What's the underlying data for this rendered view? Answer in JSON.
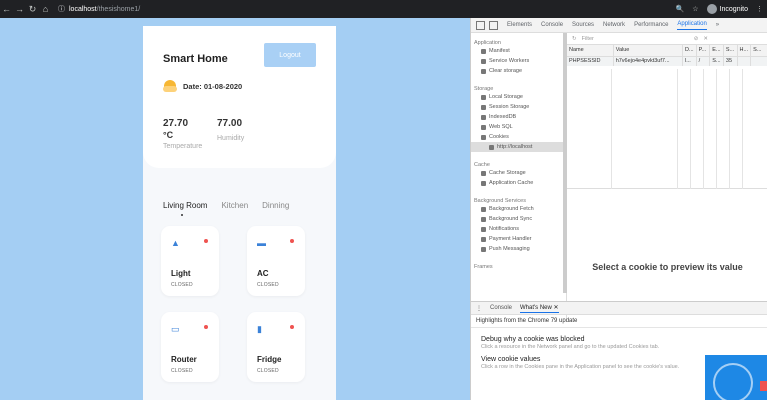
{
  "browser": {
    "url_host": "localhost",
    "url_path": "/thesishome1/",
    "profile_label": "Incognito"
  },
  "app": {
    "title": "Smart Home",
    "logout_label": "Logout",
    "date_text": "Date: 01-08-2020",
    "temperature": {
      "value": "27.70",
      "unit": "°C",
      "label": "Temperature"
    },
    "humidity": {
      "value": "77.00",
      "label": "Humidity"
    },
    "rooms": [
      {
        "label": "Living Room",
        "active": true
      },
      {
        "label": "Kitchen",
        "active": false
      },
      {
        "label": "Dinning",
        "active": false
      }
    ],
    "devices": [
      {
        "name": "Light",
        "state": "CLOSED",
        "icon": "lamp-icon"
      },
      {
        "name": "AC",
        "state": "CLOSED",
        "icon": "ac-icon"
      },
      {
        "name": "Router",
        "state": "CLOSED",
        "icon": "router-icon"
      },
      {
        "name": "Fridge",
        "state": "CLOSED",
        "icon": "fridge-icon"
      }
    ],
    "colors": {
      "background": "#a4cef3",
      "logout": "#a9d0f5",
      "status_off": "#ef5350",
      "icon": "#3b82d8"
    }
  },
  "devtools": {
    "tabs": [
      "Elements",
      "Console",
      "Sources",
      "Network",
      "Performance",
      "Application",
      "»"
    ],
    "active_tab": "Application",
    "sidebar": {
      "application_header": "Application",
      "application_items": [
        "Manifest",
        "Service Workers",
        "Clear storage"
      ],
      "storage_header": "Storage",
      "storage_items": [
        "Local Storage",
        "Session Storage",
        "IndexedDB",
        "Web SQL",
        "Cookies"
      ],
      "cookies_child": "http://localhost",
      "cache_header": "Cache",
      "cache_items": [
        "Cache Storage",
        "Application Cache"
      ],
      "bg_header": "Background Services",
      "bg_items": [
        "Background Fetch",
        "Background Sync",
        "Notifications",
        "Payment Handler",
        "Push Messaging"
      ],
      "frames_header": "Frames"
    },
    "filter_placeholder": "Filter",
    "cookie_columns": [
      "Name",
      "Value",
      "D...",
      "P...",
      "E...",
      "S...",
      "H...",
      "S..."
    ],
    "cookie_rows": [
      [
        "PHPSESSID",
        "h7v6ejo4e4pvkt3uf7...",
        "l...",
        "/",
        "S...",
        "35",
        "",
        ""
      ]
    ],
    "preview_text": "Select a cookie to preview its value",
    "drawer": {
      "tabs": [
        "Console",
        "What's New"
      ],
      "highlights": "Highlights from the Chrome 79 update",
      "items": [
        {
          "title": "Debug why a cookie was blocked",
          "desc": "Click a resource in the Network panel and go to the updated Cookies tab."
        },
        {
          "title": "View cookie values",
          "desc": "Click a row in the Cookies pane in the Application panel to see the cookie's value."
        }
      ]
    }
  }
}
